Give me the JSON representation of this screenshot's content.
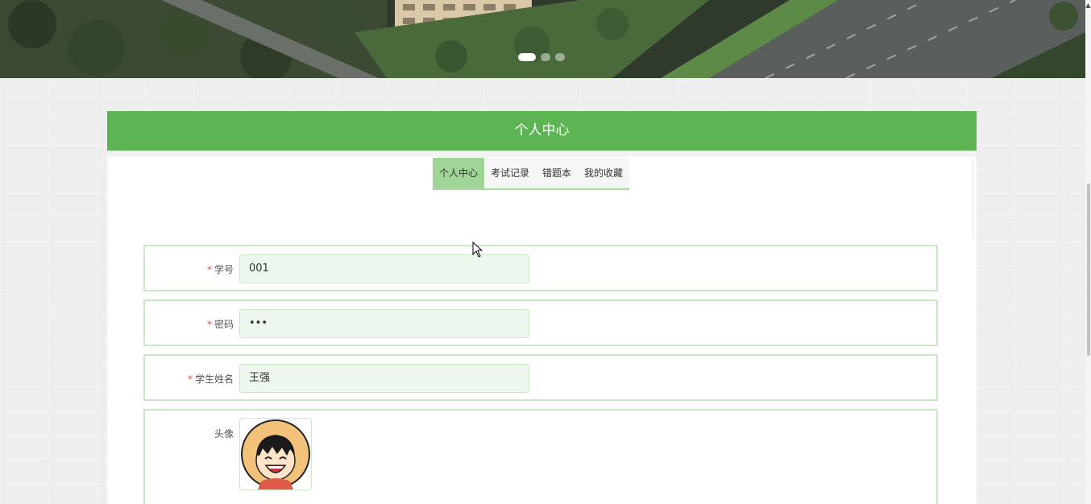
{
  "carousel": {
    "slide_count": 3,
    "active_index": 0
  },
  "panel": {
    "title": "个人中心"
  },
  "tabs": [
    {
      "label": "个人中心",
      "active": true
    },
    {
      "label": "考试记录",
      "active": false
    },
    {
      "label": "错题本",
      "active": false
    },
    {
      "label": "我的收藏",
      "active": false
    }
  ],
  "form": {
    "student_id": {
      "label": "学号",
      "required_mark": "*",
      "value": "001"
    },
    "password": {
      "label": "密码",
      "required_mark": "*",
      "value": "•••"
    },
    "student_name": {
      "label": "学生姓名",
      "required_mark": "*",
      "value": "王强"
    },
    "avatar": {
      "label": "头像"
    }
  },
  "colors": {
    "header_green": "#5cb452",
    "tab_active": "#9fd596",
    "input_border": "#c9e8c4",
    "input_bg": "#eef7ed",
    "required": "#e74c3c"
  }
}
